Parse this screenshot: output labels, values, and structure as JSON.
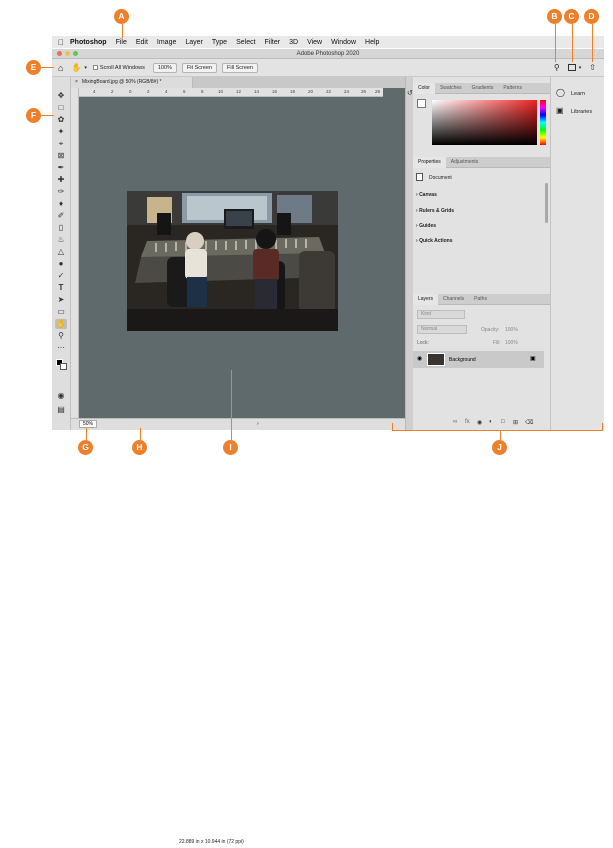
{
  "menubar": {
    "app_name": "Photoshop",
    "items": [
      "File",
      "Edit",
      "Image",
      "Layer",
      "Type",
      "Select",
      "Filter",
      "3D",
      "View",
      "Window",
      "Help"
    ]
  },
  "window": {
    "title": "Adobe Photoshop 2020"
  },
  "options_bar": {
    "scroll_all_label": "Scroll All Windows",
    "zoom_100_label": "100%",
    "fit_screen_label": "Fit Screen",
    "fill_screen_label": "Fill Screen"
  },
  "document": {
    "tab_label": "MixingBoard.jpg @ 50% (RGB/8#) *",
    "zoom_value": "50%",
    "info": "22.889 in x 10.944 in (72 ppi)",
    "ruler_ticks": [
      "4",
      "2",
      "0",
      "2",
      "4",
      "6",
      "8",
      "10",
      "12",
      "14",
      "16",
      "18",
      "20",
      "22",
      "24",
      "26",
      "28"
    ]
  },
  "color_panel": {
    "tabs": [
      "Color",
      "Swatches",
      "Gradients",
      "Patterns"
    ],
    "colors": {
      "accent": "#ee2222"
    }
  },
  "properties_panel": {
    "tabs": [
      "Properties",
      "Adjustments"
    ],
    "doc_label": "Document",
    "sections": [
      "Canvas",
      "Rulers & Grids",
      "Guides",
      "Quick Actions"
    ]
  },
  "layers_panel": {
    "tabs": [
      "Layers",
      "Channels",
      "Paths"
    ],
    "search_placeholder": "Kind",
    "blend_mode": "Normal",
    "opacity_label": "Opacity:",
    "opacity_value": "100%",
    "lock_label": "Lock:",
    "fill_label": "Fill:",
    "fill_value": "100%",
    "layer_name": "Background"
  },
  "right_strip": {
    "learn": "Learn",
    "libraries": "Libraries"
  },
  "callouts": [
    "A",
    "B",
    "C",
    "D",
    "E",
    "F",
    "G",
    "H",
    "I",
    "J"
  ],
  "colors": {
    "callout": "#ee7f2b",
    "doc_bg": "#5f6a6d"
  }
}
